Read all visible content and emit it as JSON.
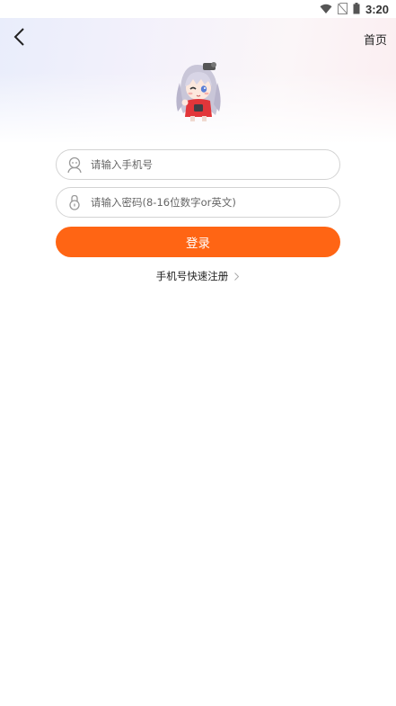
{
  "status_bar": {
    "time": "3:20",
    "icons": [
      "wifi-icon",
      "no-sim-icon",
      "battery-icon"
    ]
  },
  "header": {
    "back_icon": "chevron-left-icon",
    "home_label": "首页"
  },
  "login_form": {
    "phone": {
      "icon": "user-icon",
      "value": "",
      "placeholder": "请输入手机号"
    },
    "password": {
      "icon": "lock-icon",
      "value": "",
      "placeholder": "请输入密码(8-16位数字or英文)"
    },
    "submit_label": "登录",
    "register_label": "手机号快速注册",
    "register_icon": "chevron-right-icon"
  },
  "colors": {
    "accent": "#ff6514",
    "field_border": "#d3d3d3",
    "hero_gradient_left": "#e9edfb",
    "hero_gradient_right": "#fbeef1"
  }
}
